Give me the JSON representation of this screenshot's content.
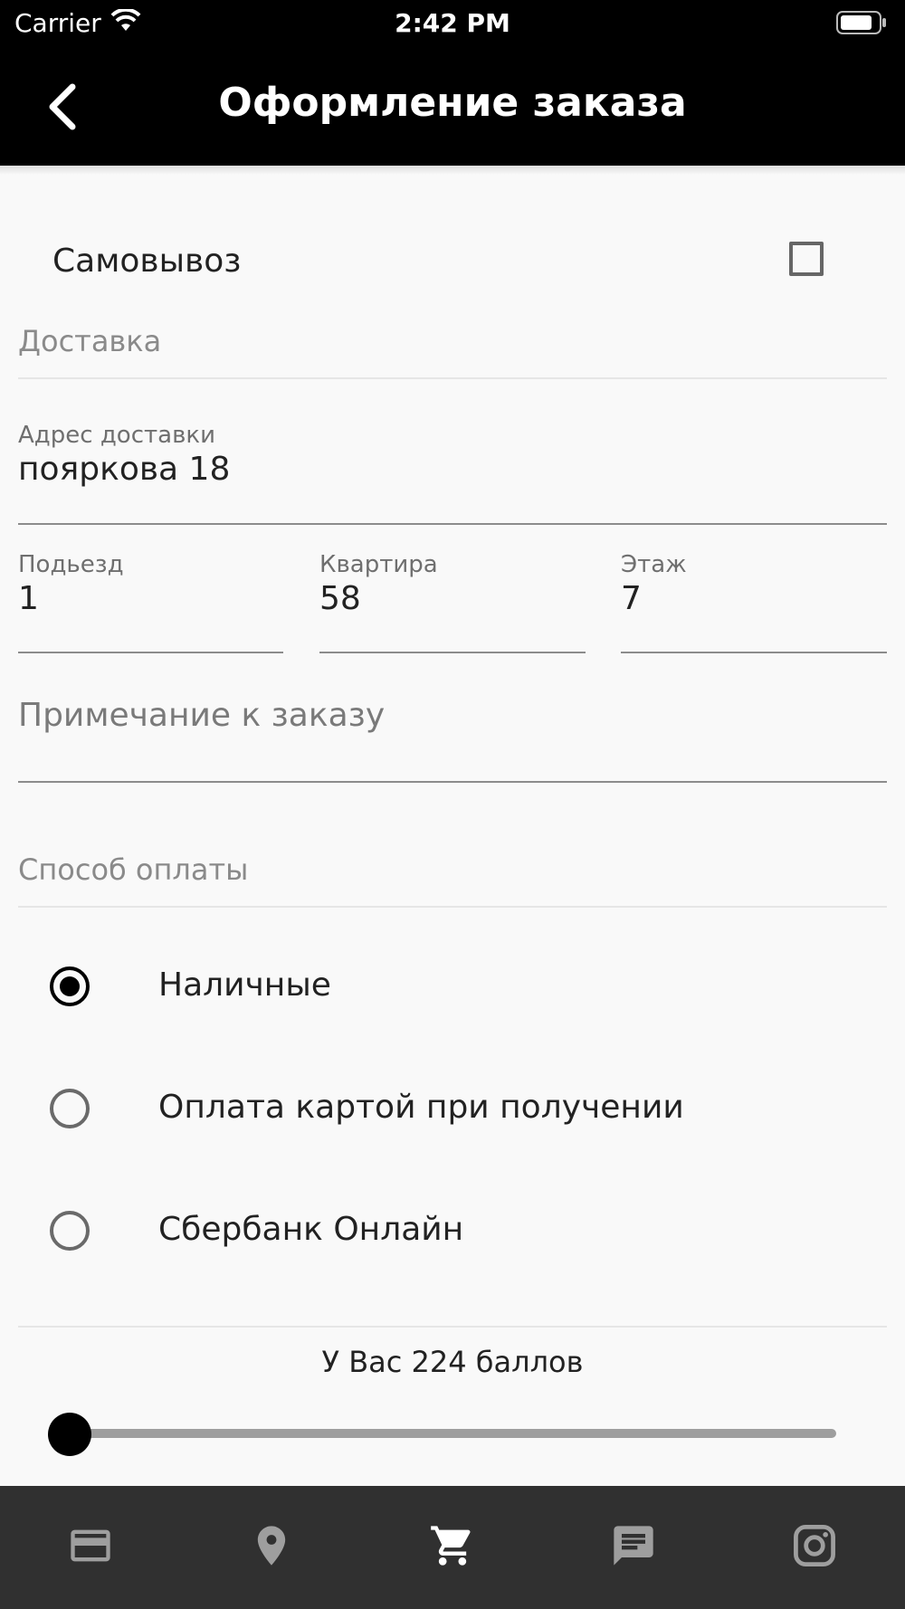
{
  "status_bar": {
    "carrier": "Carrier",
    "time": "2:42 PM"
  },
  "header": {
    "title": "Оформление заказа"
  },
  "pickup": {
    "label": "Самовывоз",
    "checked": false
  },
  "delivery": {
    "section_label": "Доставка",
    "address": {
      "label": "Адрес доставки",
      "value": "пояркова 18"
    },
    "entrance": {
      "label": "Подьезд",
      "value": "1"
    },
    "apartment": {
      "label": "Квартира",
      "value": "58"
    },
    "floor": {
      "label": "Этаж",
      "value": "7"
    },
    "note": {
      "placeholder": "Примечание к заказу",
      "value": ""
    }
  },
  "payment": {
    "section_label": "Способ оплаты",
    "options": [
      {
        "label": "Наличные",
        "selected": true
      },
      {
        "label": "Оплата картой при получении",
        "selected": false
      },
      {
        "label": "Сбербанк Онлайн",
        "selected": false
      }
    ]
  },
  "points": {
    "text": "У Вас 224 баллов",
    "slider_value": 0
  },
  "bottom_nav": {
    "items": [
      {
        "icon": "credit-card-icon",
        "active": false
      },
      {
        "icon": "location-pin-icon",
        "active": false
      },
      {
        "icon": "cart-icon",
        "active": true
      },
      {
        "icon": "message-icon",
        "active": false
      },
      {
        "icon": "instagram-icon",
        "active": false
      }
    ],
    "active_color": "#ffffff",
    "inactive_color": "#9e9e9e"
  }
}
